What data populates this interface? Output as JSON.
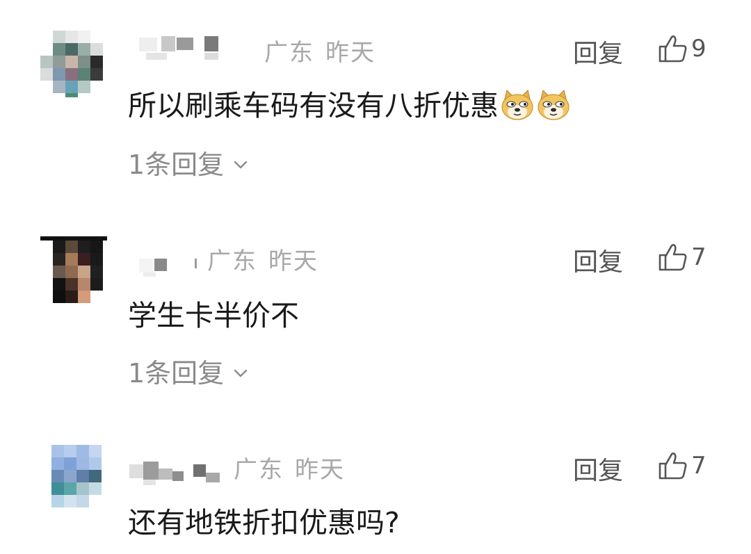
{
  "comments": [
    {
      "meta": {
        "location": "广东",
        "time": "昨天"
      },
      "reply_label": "回复",
      "like_count": "9",
      "text": "所以刷乘车码有没有八折优惠",
      "emoji_icon": "doge-emoji",
      "replies_label": "1条回复"
    },
    {
      "meta": {
        "location": "广东",
        "time": "昨天"
      },
      "reply_label": "回复",
      "like_count": "7",
      "text": "学生卡半价不",
      "replies_label": "1条回复"
    },
    {
      "meta": {
        "location": "广东",
        "time": "昨天"
      },
      "reply_label": "回复",
      "like_count": "7",
      "text": "还有地铁折扣优惠吗?"
    }
  ],
  "colors": {
    "meta_text": "#a8a8a8",
    "action_text": "#555555",
    "body_text": "#1a1a1a",
    "replies_text": "#8a8a8a"
  }
}
